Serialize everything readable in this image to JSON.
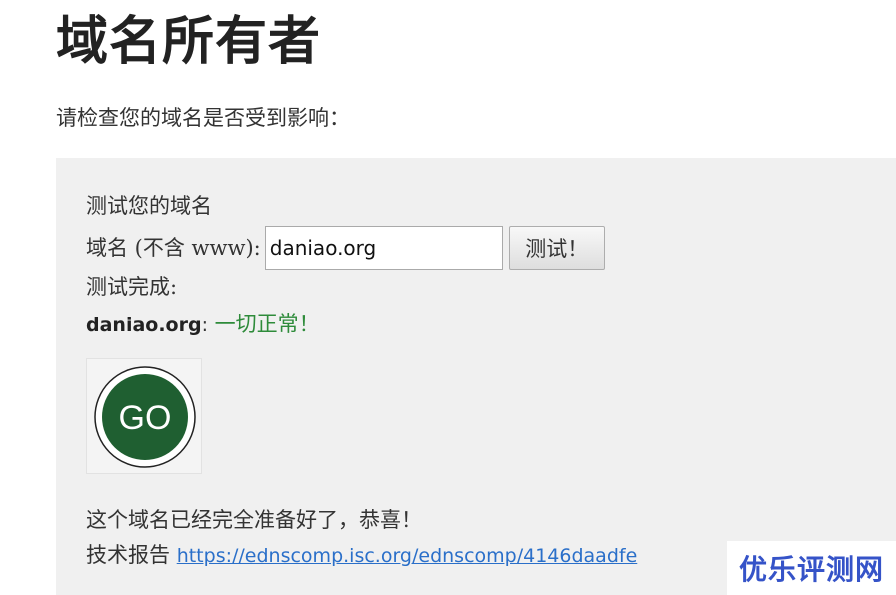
{
  "header": {
    "title": "域名所有者",
    "intro": "请检查您的域名是否受到影响："
  },
  "test_panel": {
    "heading": "测试您的域名",
    "domain_label": "域名 (不含 www):",
    "domain_value": "daniao.org",
    "test_button_label": "测试！",
    "done_label": "测试完成:",
    "result": {
      "domain": "daniao.org",
      "separator": ":",
      "status": " 一切正常！",
      "status_color": "#2e8b3a"
    },
    "badge": {
      "text": "GO",
      "fill_color": "#1f5f31"
    },
    "congrats": "这个域名已经完全准备好了，恭喜！",
    "report_label": "技术报告",
    "report_link": "https://ednscomp.isc.org/ednscomp/4146daadfe"
  },
  "watermark": {
    "text": "优乐评测网",
    "color": "#3553c8"
  }
}
